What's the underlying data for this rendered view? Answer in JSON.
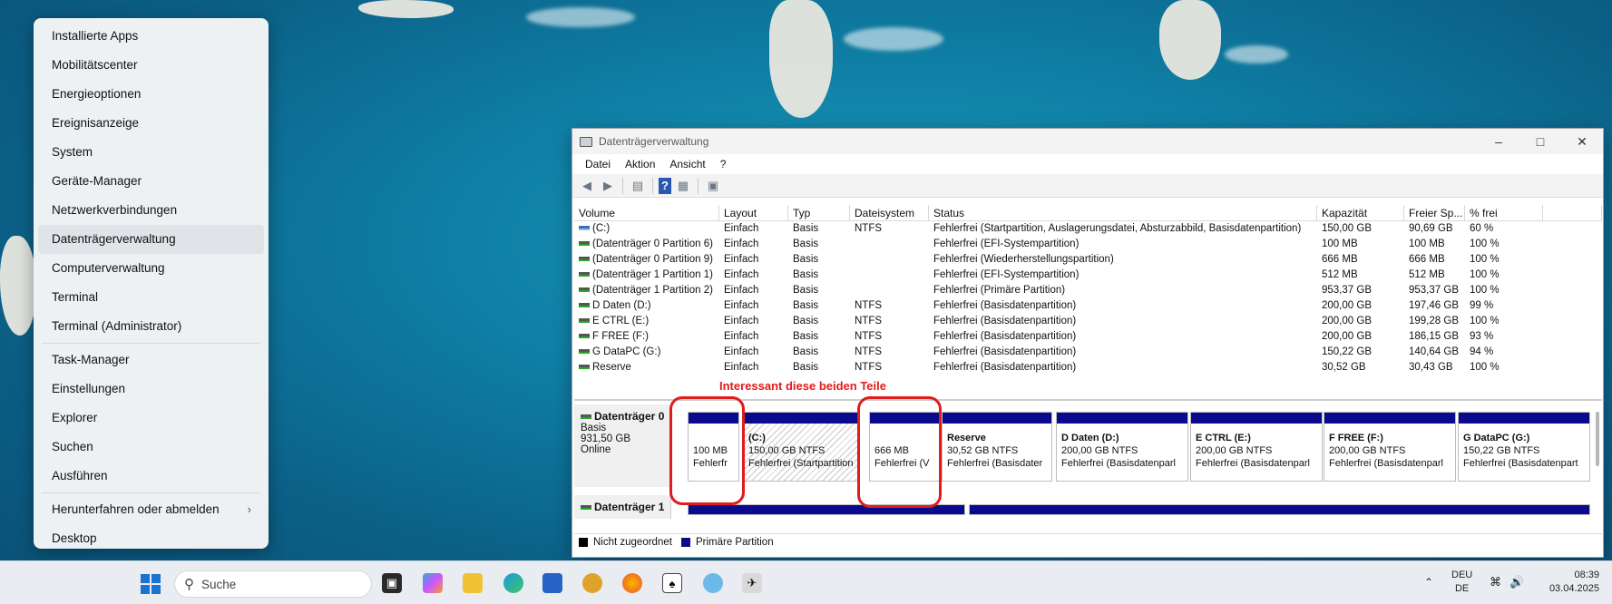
{
  "winx_menu": {
    "items": [
      {
        "label": "Installierte Apps"
      },
      {
        "label": "Mobilitätscenter"
      },
      {
        "label": "Energieoptionen"
      },
      {
        "label": "Ereignisanzeige"
      },
      {
        "label": "System"
      },
      {
        "label": "Geräte-Manager"
      },
      {
        "label": "Netzwerkverbindungen"
      },
      {
        "label": "Datenträgerverwaltung"
      },
      {
        "label": "Computerverwaltung"
      },
      {
        "label": "Terminal"
      },
      {
        "label": "Terminal (Administrator)"
      },
      {
        "label": "Task-Manager"
      },
      {
        "label": "Einstellungen"
      },
      {
        "label": "Explorer"
      },
      {
        "label": "Suchen"
      },
      {
        "label": "Ausführen"
      },
      {
        "label": "Herunterfahren oder abmelden"
      },
      {
        "label": "Desktop"
      }
    ]
  },
  "window": {
    "title": "Datenträgerverwaltung",
    "menu": [
      "Datei",
      "Aktion",
      "Ansicht",
      "?"
    ]
  },
  "volumes": {
    "headers": [
      "Volume",
      "Layout",
      "Typ",
      "Dateisystem",
      "Status",
      "Kapazität",
      "Freier Sp...",
      "% frei",
      ""
    ],
    "rows": [
      [
        "(C:)",
        "Einfach",
        "Basis",
        "NTFS",
        "Fehlerfrei (Startpartition, Auslagerungsdatei, Absturzabbild, Basisdatenpartition)",
        "150,00 GB",
        "90,69 GB",
        "60 %"
      ],
      [
        "(Datenträger 0 Partition 6)",
        "Einfach",
        "Basis",
        "",
        "Fehlerfrei (EFI-Systempartition)",
        "100 MB",
        "100 MB",
        "100 %"
      ],
      [
        "(Datenträger 0 Partition 9)",
        "Einfach",
        "Basis",
        "",
        "Fehlerfrei (Wiederherstellungspartition)",
        "666 MB",
        "666 MB",
        "100 %"
      ],
      [
        "(Datenträger 1 Partition 1)",
        "Einfach",
        "Basis",
        "",
        "Fehlerfrei (EFI-Systempartition)",
        "512 MB",
        "512 MB",
        "100 %"
      ],
      [
        "(Datenträger 1 Partition 2)",
        "Einfach",
        "Basis",
        "",
        "Fehlerfrei (Primäre Partition)",
        "953,37 GB",
        "953,37 GB",
        "100 %"
      ],
      [
        "D Daten (D:)",
        "Einfach",
        "Basis",
        "NTFS",
        "Fehlerfrei (Basisdatenpartition)",
        "200,00 GB",
        "197,46 GB",
        "99 %"
      ],
      [
        "E CTRL (E:)",
        "Einfach",
        "Basis",
        "NTFS",
        "Fehlerfrei (Basisdatenpartition)",
        "200,00 GB",
        "199,28 GB",
        "100 %"
      ],
      [
        "F FREE (F:)",
        "Einfach",
        "Basis",
        "NTFS",
        "Fehlerfrei (Basisdatenpartition)",
        "200,00 GB",
        "186,15 GB",
        "93 %"
      ],
      [
        "G DataPC (G:)",
        "Einfach",
        "Basis",
        "NTFS",
        "Fehlerfrei (Basisdatenpartition)",
        "150,22 GB",
        "140,64 GB",
        "94 %"
      ],
      [
        "Reserve",
        "Einfach",
        "Basis",
        "NTFS",
        "Fehlerfrei (Basisdatenpartition)",
        "30,52 GB",
        "30,43 GB",
        "100 %"
      ]
    ]
  },
  "annotation": "Interessant diese beiden Teile",
  "disk0": {
    "name": "Datenträger 0",
    "type": "Basis",
    "size": "931,50 GB",
    "state": "Online",
    "partitions": [
      {
        "name": "",
        "size": "100 MB",
        "status": "Fehlerfr"
      },
      {
        "name": "(C:)",
        "size": "150,00 GB NTFS",
        "status": "Fehlerfrei (Startpartition"
      },
      {
        "name": "",
        "size": "666 MB",
        "status": "Fehlerfrei (V"
      },
      {
        "name": "Reserve",
        "size": "30,52 GB NTFS",
        "status": "Fehlerfrei (Basisdater"
      },
      {
        "name": "D Daten  (D:)",
        "size": "200,00 GB NTFS",
        "status": "Fehlerfrei (Basisdatenparl"
      },
      {
        "name": "E CTRL  (E:)",
        "size": "200,00 GB NTFS",
        "status": "Fehlerfrei (Basisdatenparl"
      },
      {
        "name": "F FREE  (F:)",
        "size": "200,00 GB NTFS",
        "status": "Fehlerfrei (Basisdatenparl"
      },
      {
        "name": "G DataPC  (G:)",
        "size": "150,22 GB NTFS",
        "status": "Fehlerfrei (Basisdatenpart"
      }
    ]
  },
  "disk1": {
    "name": "Datenträger 1"
  },
  "legend": {
    "unallocated": "Nicht zugeordnet",
    "primary": "Primäre Partition",
    "colors": {
      "unallocated": "#000000",
      "primary": "#0a0a8c"
    }
  },
  "taskbar": {
    "search_placeholder": "Suche",
    "lang_top": "DEU",
    "lang_bottom": "DE",
    "time": "08:39",
    "date": "03.04.2025"
  }
}
